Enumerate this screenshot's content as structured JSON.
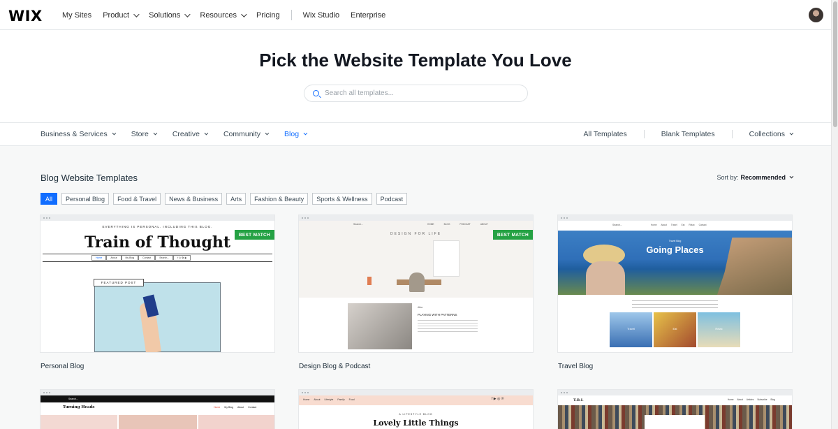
{
  "brand": {
    "logo": "WIX",
    "accent": "#116dff",
    "badge_color": "#25a244"
  },
  "nav": {
    "items": [
      "My Sites",
      "Product",
      "Solutions",
      "Resources",
      "Pricing",
      "Wix Studio",
      "Enterprise"
    ]
  },
  "hero": {
    "title": "Pick the Website Template You Love",
    "search_placeholder": "Search all templates..."
  },
  "categories": {
    "left": [
      "Business & Services",
      "Store",
      "Creative",
      "Community",
      "Blog"
    ],
    "active": "Blog",
    "right": [
      "All Templates",
      "Blank Templates",
      "Collections"
    ]
  },
  "section": {
    "title": "Blog Website Templates",
    "sort_label": "Sort by:",
    "sort_value": "Recommended"
  },
  "filters": [
    "All",
    "Personal Blog",
    "Food & Travel",
    "News & Business",
    "Arts",
    "Fashion & Beauty",
    "Sports & Wellness",
    "Podcast"
  ],
  "cards": [
    {
      "name": "Personal Blog",
      "badge": "BEST MATCH",
      "preview": {
        "tagline": "EVERYTHING IS PERSONAL. INCLUDING THIS BLOG.",
        "headline": "Train of Thought",
        "menu": [
          "Home",
          "About",
          "My Blog",
          "Contact",
          "Search..."
        ],
        "featured": "FEATURED POST"
      }
    },
    {
      "name": "Design Blog & Podcast",
      "badge": "BEST MATCH",
      "preview": {
        "search": "Search...",
        "menu": [
          "HOME",
          "BLOG",
          "PODCAST",
          "ABOUT"
        ],
        "tagline": "DESIGN FOR LIFE",
        "author": "Alba",
        "post_title": "PLAYING WITH PATTERNS"
      }
    },
    {
      "name": "Travel Blog",
      "badge": "",
      "preview": {
        "search": "Search...",
        "menu": [
          "Home",
          "About",
          "Travel",
          "Eat",
          "Relax",
          "Contact"
        ],
        "kicker": "Travel Blog",
        "headline": "Going Places",
        "thumbs": [
          "Travel",
          "Eat",
          "Relax"
        ]
      }
    },
    {
      "name": "",
      "badge": "",
      "preview": {
        "search": "Search...",
        "headline": "Turning Heads",
        "menu": [
          "Home",
          "My Blog",
          "About",
          "Contact"
        ]
      }
    },
    {
      "name": "",
      "badge": "",
      "preview": {
        "menu": [
          "Home",
          "About",
          "Lifestyle",
          "Family",
          "Food"
        ],
        "kicker": "A LIFESTYLE BLOG",
        "headline": "Lovely Little Things"
      }
    },
    {
      "name": "",
      "badge": "",
      "preview": {
        "logo": "T.B.L",
        "menu": [
          "Home",
          "About",
          "Articles",
          "Subscribe",
          "Blog"
        ]
      }
    }
  ]
}
